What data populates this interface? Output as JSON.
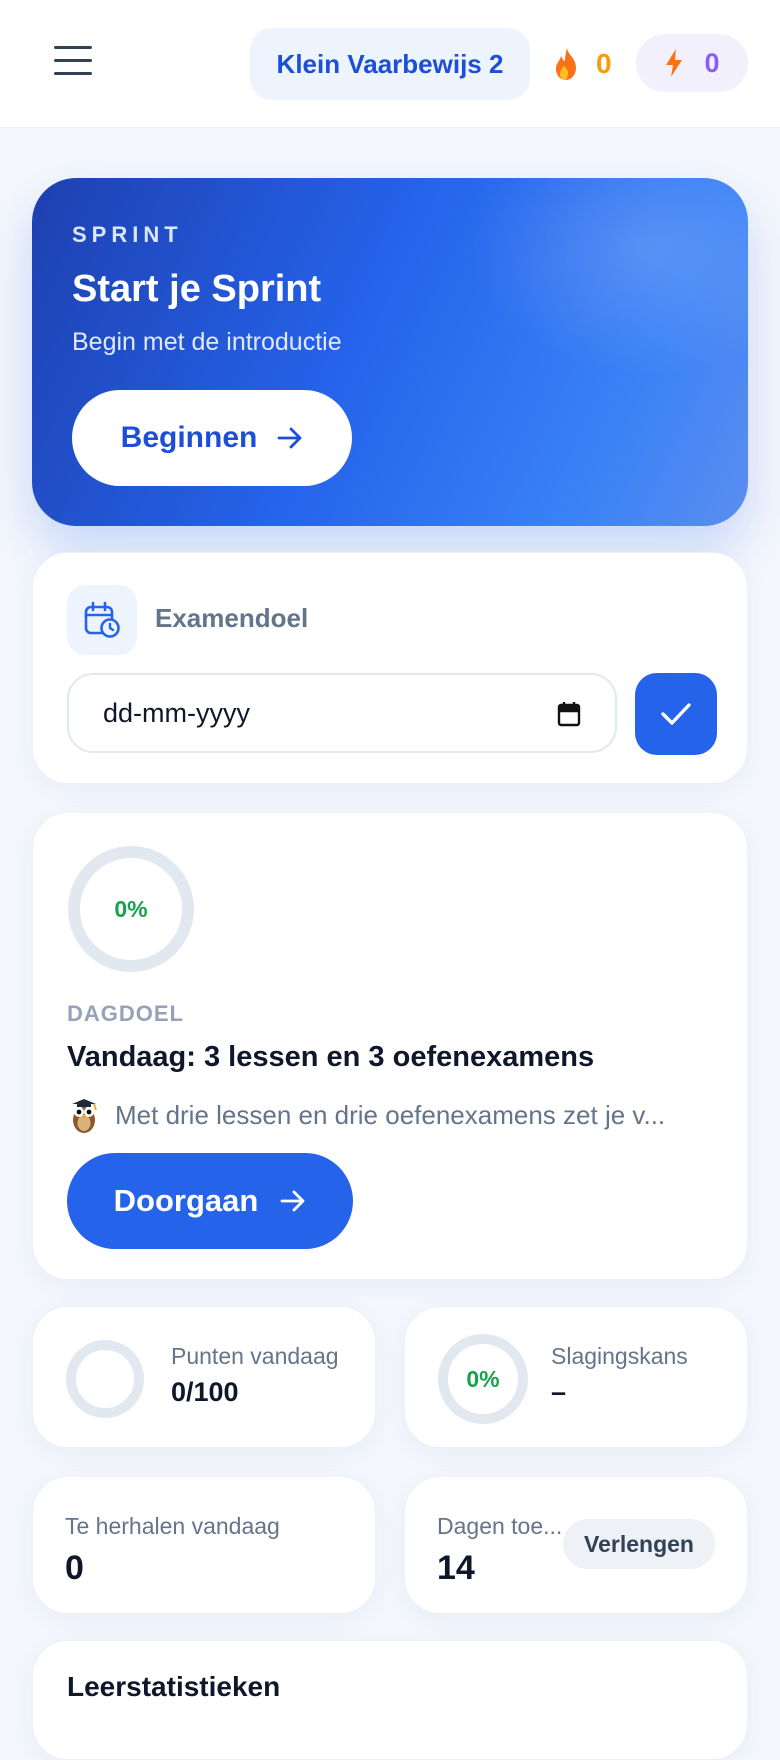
{
  "header": {
    "course_label": "Klein Vaarbewijs 2",
    "streak_value": "0",
    "energy_value": "0"
  },
  "hero": {
    "kicker": "SPRINT",
    "title": "Start je Sprint",
    "subtitle": "Begin met de introductie",
    "cta_label": "Beginnen"
  },
  "exam_goal": {
    "label": "Examendoel",
    "date_placeholder": "dd-mm-yyyy"
  },
  "daily_goal": {
    "progress_label": "0%",
    "progress_fraction": 0,
    "kicker": "DAGDOEL",
    "title": "Vandaag: 3 lessen en 3 oefenexamens",
    "description": "Met drie lessen en drie oefenexamens zet je v...",
    "cta_label": "Doorgaan"
  },
  "stats": {
    "points_label": "Punten vandaag",
    "points_value": "0/100",
    "pass_chance_label": "Slagingskans",
    "pass_chance_ring": "0%",
    "pass_chance_value": "–",
    "review_label": "Te herhalen vandaag",
    "review_value": "0",
    "access_label": "Dagen toe...",
    "access_value": "14",
    "extend_label": "Verlengen"
  },
  "learning_stats": {
    "title": "Leerstatistieken"
  },
  "colors": {
    "accent": "#2563eb",
    "success": "#16a34a",
    "streak": "#f59e0b",
    "energy": "#8b5cf6"
  },
  "icons": [
    "menu-icon",
    "flame-icon",
    "bolt-icon",
    "arrow-right-icon",
    "calendar-clock-icon",
    "calendar-icon",
    "check-icon",
    "owl-icon"
  ]
}
